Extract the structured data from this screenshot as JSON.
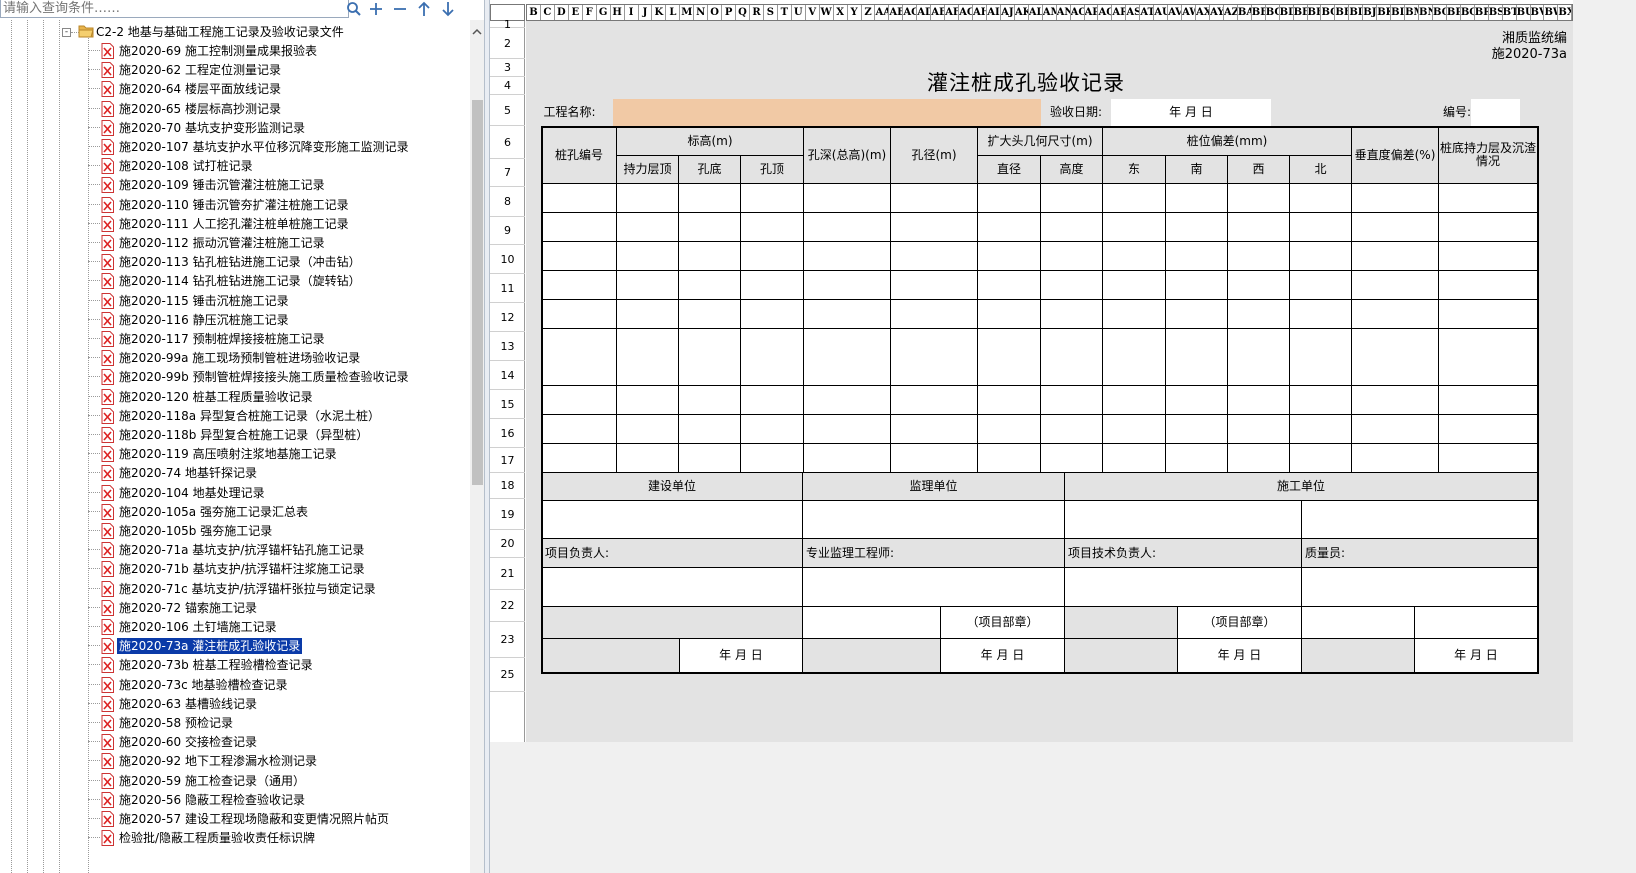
{
  "search": {
    "placeholder": "请输入查询条件……"
  },
  "toolbar": {
    "search_icon": "search-icon",
    "add_icon": "plus-icon",
    "remove_icon": "minus-icon",
    "up_icon": "arrow-up-icon",
    "down_icon": "arrow-down-icon"
  },
  "tree": {
    "folder_label": "C2-2 地基与基础工程施工记录及验收记录文件",
    "items": [
      "施2020-69 施工控制测量成果报验表",
      "施2020-62 工程定位测量记录",
      "施2020-64 楼层平面放线记录",
      "施2020-65 楼层标高抄测记录",
      "施2020-70 基坑支护变形监测记录",
      "施2020-107 基坑支护水平位移沉降变形施工监测记录",
      "施2020-108 试打桩记录",
      "施2020-109 锤击沉管灌注桩施工记录",
      "施2020-110 锤击沉管夯扩灌注桩施工记录",
      "施2020-111 人工挖孔灌注桩单桩施工记录",
      "施2020-112 振动沉管灌注桩施工记录",
      "施2020-113 钻孔桩钻进施工记录（冲击钻）",
      "施2020-114 钻孔桩钻进施工记录（旋转钻）",
      "施2020-115 锤击沉桩施工记录",
      "施2020-116 静压沉桩施工记录",
      "施2020-117 预制桩焊接接桩施工记录",
      "施2020-99a 施工现场预制管桩进场验收记录",
      "施2020-99b 预制管桩焊接接头施工质量检查验收记录",
      "施2020-120 桩基工程质量验收记录",
      "施2020-118a 异型复合桩施工记录（水泥土桩）",
      "施2020-118b 异型复合桩施工记录（异型桩）",
      "施2020-119 高压喷射注浆地基施工记录",
      "施2020-74 地基钎探记录",
      "施2020-104 地基处理记录",
      "施2020-105a 强夯施工记录汇总表",
      "施2020-105b 强夯施工记录",
      "施2020-71a 基坑支护/抗浮锚杆钻孔施工记录",
      "施2020-71b 基坑支护/抗浮锚杆注浆施工记录",
      "施2020-71c 基坑支护/抗浮锚杆张拉与锁定记录",
      "施2020-72 锚索施工记录",
      "施2020-106 土钉墙施工记录",
      "施2020-73a 灌注桩成孔验收记录",
      "施2020-73b 桩基工程验槽检查记录",
      "施2020-73c 地基验槽检查记录",
      "施2020-63 基槽验线记录",
      "施2020-58 预检记录",
      "施2020-60 交接检查记录",
      "施2020-92 地下工程渗漏水检测记录",
      "施2020-59 施工检查记录（通用）",
      "施2020-56 隐蔽工程检查验收记录",
      "施2020-57 建设工程现场隐蔽和变更情况照片帖页",
      "检验批/隐蔽工程质量验收责任标识牌"
    ],
    "selected_index": 31
  },
  "sheet": {
    "columns": [
      "B",
      "C",
      "D",
      "E",
      "F",
      "G",
      "H",
      "I",
      "J",
      "K",
      "L",
      "M",
      "N",
      "O",
      "P",
      "Q",
      "R",
      "S",
      "T",
      "U",
      "V",
      "W",
      "X",
      "Y",
      "Z",
      "AA",
      "AB",
      "AC",
      "AD",
      "AE",
      "AF",
      "AG",
      "AH",
      "AI",
      "AJ",
      "AK",
      "AL",
      "AM",
      "AN",
      "AO",
      "AP",
      "AQ",
      "AR",
      "AS",
      "AT",
      "AU",
      "AV",
      "AW",
      "AX",
      "AY",
      "AZ",
      "BA",
      "BB",
      "BC",
      "BD",
      "BE",
      "BF",
      "BG",
      "BH",
      "BI",
      "BJ",
      "BK",
      "BL",
      "BM",
      "BN",
      "BO",
      "BP",
      "BQ",
      "BR",
      "BS",
      "BT",
      "BU",
      "BV",
      "BW",
      "BX"
    ],
    "rows": [
      "1",
      "2",
      "3",
      "4",
      "5",
      "6",
      "7",
      "8",
      "9",
      "10",
      "11",
      "12",
      "13",
      "14",
      "15",
      "16",
      "17",
      "18",
      "19",
      "20",
      "21",
      "22",
      "23",
      "25"
    ],
    "org": "湘质监统编",
    "code": "施2020-73a",
    "title": "灌注桩成孔验收记录",
    "project_label": "工程名称:",
    "project_value": "",
    "date_label": "验收日期:",
    "date_value": "年    月    日",
    "number_label": "编号:",
    "number_value": "",
    "headers": {
      "pile_no": "桩孔编号",
      "elevation": "标高(m)",
      "bearing_top": "持力层顶",
      "hole_bottom": "孔底",
      "hole_top": "孔顶",
      "depth": "孔深(总高)(m)",
      "diameter": "孔径(m)",
      "expand": "扩大头几何尺寸(m)",
      "exp_diameter": "直径",
      "exp_height": "高度",
      "deviation": "桩位偏差(mm)",
      "east": "东",
      "south": "南",
      "west": "西",
      "north": "北",
      "vertical": "垂直度偏差(%)",
      "bottom": "桩底持力层及沉渣情况"
    },
    "units": {
      "builder": "建设单位",
      "supervisor": "监理单位",
      "contractor": "施工单位"
    },
    "signatures": {
      "project_leader": "项目负责人:",
      "supervision_engineer": "专业监理工程师:",
      "tech_leader": "项目技术负责人:",
      "quality_officer": "质量员:"
    },
    "seal": "（项目部章）",
    "date_sign": "年    月    日"
  }
}
